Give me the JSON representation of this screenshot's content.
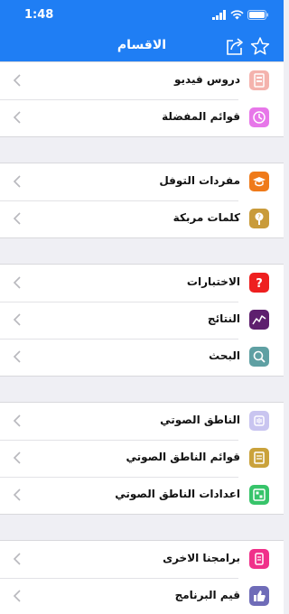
{
  "status": {
    "time": "1:48"
  },
  "navbar": {
    "title": "الاقسام"
  },
  "groups": [
    {
      "items": [
        {
          "label": "دروس فيديو",
          "icon": "video-lessons-icon",
          "color": "#f4b3ad"
        },
        {
          "label": "قوائم المفضلة",
          "icon": "favorites-list-icon",
          "color": "#e777e9"
        }
      ]
    },
    {
      "items": [
        {
          "label": "مفردات التوفل",
          "icon": "graduation-cap-icon",
          "color": "#ef7a1a"
        },
        {
          "label": "كلمات مربكة",
          "icon": "magnifier-question-icon",
          "color": "#c99b3a"
        }
      ]
    },
    {
      "items": [
        {
          "label": "الاختبارات",
          "icon": "question-mark-icon",
          "color": "#ee1f1f"
        },
        {
          "label": "النتائج",
          "icon": "line-graph-icon",
          "color": "#5e1f6e"
        },
        {
          "label": "البحث",
          "icon": "search-icon",
          "color": "#5fa0a3"
        }
      ]
    },
    {
      "items": [
        {
          "label": "الناطق الصوتي",
          "icon": "speaker-icon",
          "color": "#c9c5f0"
        },
        {
          "label": "قوائم الناطق الصوتي",
          "icon": "document-list-icon",
          "color": "#caa23b"
        },
        {
          "label": "اعدادات الناطق الصوتي",
          "icon": "settings-grid-icon",
          "color": "#37c46a"
        }
      ]
    },
    {
      "items": [
        {
          "label": "برامجنا الاخرى",
          "icon": "apps-icon",
          "color": "#f0318a"
        },
        {
          "label": "قيم البرنامج",
          "icon": "thumbs-up-icon",
          "color": "#6f6cb8"
        }
      ]
    }
  ]
}
